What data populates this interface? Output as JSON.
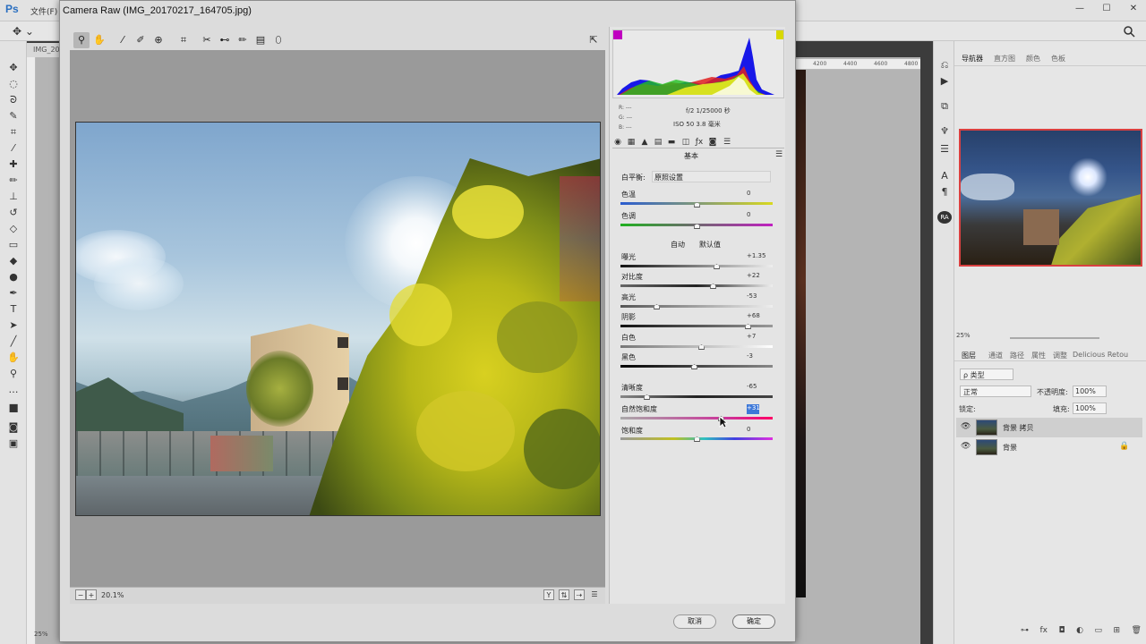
{
  "photoshop": {
    "logo": "Ps",
    "menu_file": "文件(F)",
    "zoom_label": "25%",
    "ruler_ticks": [
      "4200",
      "4400",
      "4600",
      "4800"
    ],
    "nav_tabs": [
      "导航器",
      "直方图",
      "颜色",
      "色板"
    ],
    "nav_zoom": "25%",
    "layers_tabs": [
      "图层",
      "通道",
      "路径",
      "属性",
      "调整",
      "Delicious Retou"
    ],
    "layer_kind": "ρ 类型",
    "blend_mode": "正常",
    "opacity_label": "不透明度:",
    "opacity_value": "100%",
    "lock_label": "锁定:",
    "fill_label": "填充:",
    "fill_value": "100%",
    "layers": [
      {
        "name": "背景 拷贝"
      },
      {
        "name": "背景"
      }
    ],
    "doc_tab": "IMG_20"
  },
  "camera_raw": {
    "title": "Camera Raw (IMG_20170217_164705.jpg)",
    "zoom_value": "20.1%",
    "rgb_readout": [
      "R: ---",
      "G: ---",
      "B: ---"
    ],
    "exif_line1": "f/2   1/25000 秒",
    "exif_line2": "ISO 50   3.8 毫米",
    "panel_title": "基本",
    "white_balance_label": "白平衡:",
    "white_balance_value": "原照设置",
    "auto_label": "自动",
    "default_label": "默认值",
    "sliders": {
      "temperature": {
        "label": "色温",
        "value": "0"
      },
      "tint": {
        "label": "色调",
        "value": "0"
      },
      "exposure": {
        "label": "曝光",
        "value": "+1.35"
      },
      "contrast": {
        "label": "对比度",
        "value": "+22"
      },
      "highlights": {
        "label": "高光",
        "value": "-53"
      },
      "shadows": {
        "label": "阴影",
        "value": "+68"
      },
      "whites": {
        "label": "白色",
        "value": "+7"
      },
      "blacks": {
        "label": "黑色",
        "value": "-3"
      },
      "clarity": {
        "label": "清晰度",
        "value": "-65"
      },
      "vibrance": {
        "label": "自然饱和度",
        "value": "+31"
      },
      "saturation": {
        "label": "饱和度",
        "value": "0"
      }
    },
    "cancel_label": "取消",
    "ok_label": "确定"
  }
}
